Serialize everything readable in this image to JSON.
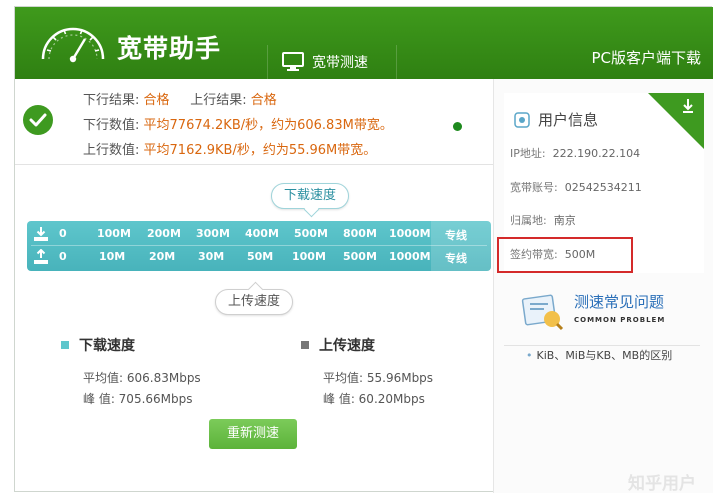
{
  "header": {
    "title": "宽带助手",
    "tab_label": "宽带测速",
    "pc_download": "PC版客户端下载"
  },
  "result": {
    "down_result_label": "下行结果:",
    "down_result_value": "合格",
    "up_result_label": "上行结果:",
    "up_result_value": "合格",
    "down_value_label": "下行数值:",
    "down_value_text": "平均77674.2KB/秒，约为606.83M带宽。",
    "up_value_label": "上行数值:",
    "up_value_text": "平均7162.9KB/秒，约为55.96M带宽。"
  },
  "speed_scale": {
    "download_label": "下载速度",
    "upload_label": "上传速度",
    "download_ticks": [
      "0",
      "100M",
      "200M",
      "300M",
      "400M",
      "500M",
      "800M",
      "1000M",
      "专线"
    ],
    "upload_ticks": [
      "0",
      "10M",
      "20M",
      "30M",
      "50M",
      "100M",
      "500M",
      "1000M",
      "专线"
    ]
  },
  "stats": {
    "download": {
      "title": "下载速度",
      "avg": "平均值: 606.83Mbps",
      "peak": "峰 值: 705.66Mbps",
      "color": "#5ec6cc"
    },
    "upload": {
      "title": "上传速度",
      "avg": "平均值: 55.96Mbps",
      "peak": "峰 值: 60.20Mbps",
      "color": "#777777"
    }
  },
  "retest_button": "重新测速",
  "user_info": {
    "title": "用户信息",
    "ip_label": "IP地址:",
    "ip_value": "222.190.22.104",
    "account_label": "宽带账号:",
    "account_value": "02542534211",
    "location_label": "归属地:",
    "location_value": "南京",
    "bandwidth_label": "签约带宽:",
    "bandwidth_value": "500M"
  },
  "faq": {
    "title": "测速常见问题",
    "subtitle": "COMMON PROBLEM",
    "link": "KiB、MiB与KB、MB的区别"
  },
  "watermark": "知乎用户",
  "colors": {
    "header_green": "#3a9418",
    "accent_teal": "#5ec6cc",
    "result_orange": "#d9670f",
    "highlight_red": "#d42a2a"
  }
}
